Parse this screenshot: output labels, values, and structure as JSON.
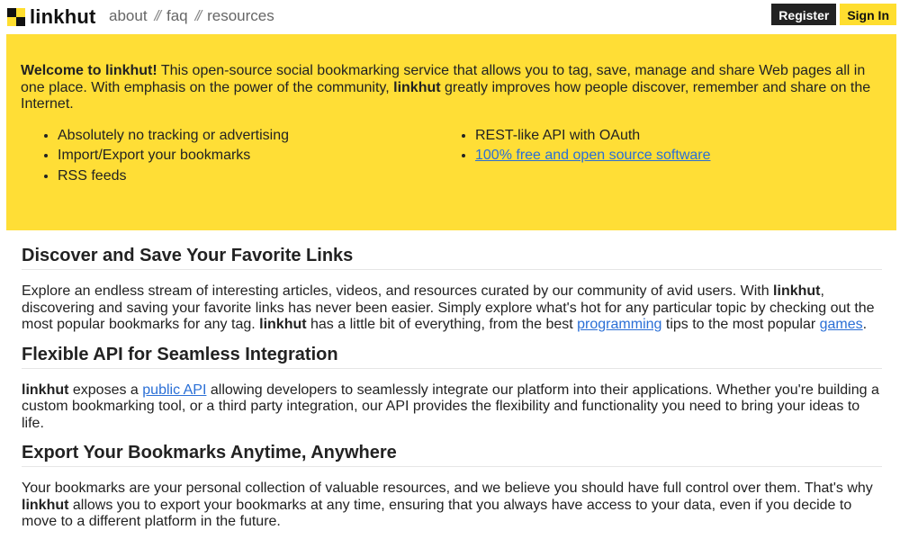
{
  "header": {
    "logo_text": "linkhut",
    "nav": [
      {
        "label": "about"
      },
      {
        "label": "faq"
      },
      {
        "label": "resources"
      }
    ],
    "nav_separator": "//",
    "register_label": "Register",
    "signin_label": "Sign In"
  },
  "hero": {
    "welcome_bold": "Welcome to linkhut!",
    "intro_1": " This open-source social bookmarking service that allows you to tag, save, manage and share Web pages all in one place. With emphasis on the power of the community, ",
    "intro_bold": "linkhut",
    "intro_2": " greatly improves how people discover, remember and share on the Internet.",
    "features_left": [
      "Absolutely no tracking or advertising",
      "Import/Export your bookmarks",
      "RSS feeds"
    ],
    "features_right_text": "REST-like API with OAuth",
    "features_right_link": "100% free and open source software"
  },
  "sections": {
    "discover": {
      "title": "Discover and Save Your Favorite Links",
      "t1": "Explore an endless stream of interesting articles, videos, and resources curated by our community of avid users. With ",
      "b1": "linkhut",
      "t2": ", discovering and saving your favorite links has never been easier. Simply explore what's hot for any particular topic by checking out the most popular bookmarks for any tag. ",
      "b2": "linkhut",
      "t3": " has a little bit of everything, from the best ",
      "link1": "programming",
      "t4": " tips to the most popular ",
      "link2": "games",
      "t5": "."
    },
    "api": {
      "title": "Flexible API for Seamless Integration",
      "b1": "linkhut",
      "t1": " exposes a ",
      "link1": "public API",
      "t2": " allowing developers to seamlessly integrate our platform into their applications. Whether you're building a custom bookmarking tool, or a third party integration, our API provides the flexibility and functionality you need to bring your ideas to life."
    },
    "export": {
      "title": "Export Your Bookmarks Anytime, Anywhere",
      "t1": "Your bookmarks are your personal collection of valuable resources, and we believe you should have full control over them. That's why ",
      "b1": "linkhut",
      "t2": " allows you to export your bookmarks at any time, ensuring that you always have access to your data, even if you decide to move to a different platform in the future."
    }
  },
  "colors": {
    "accent_yellow": "#ffde36",
    "dark": "#222222",
    "link": "#2a6fd6"
  }
}
